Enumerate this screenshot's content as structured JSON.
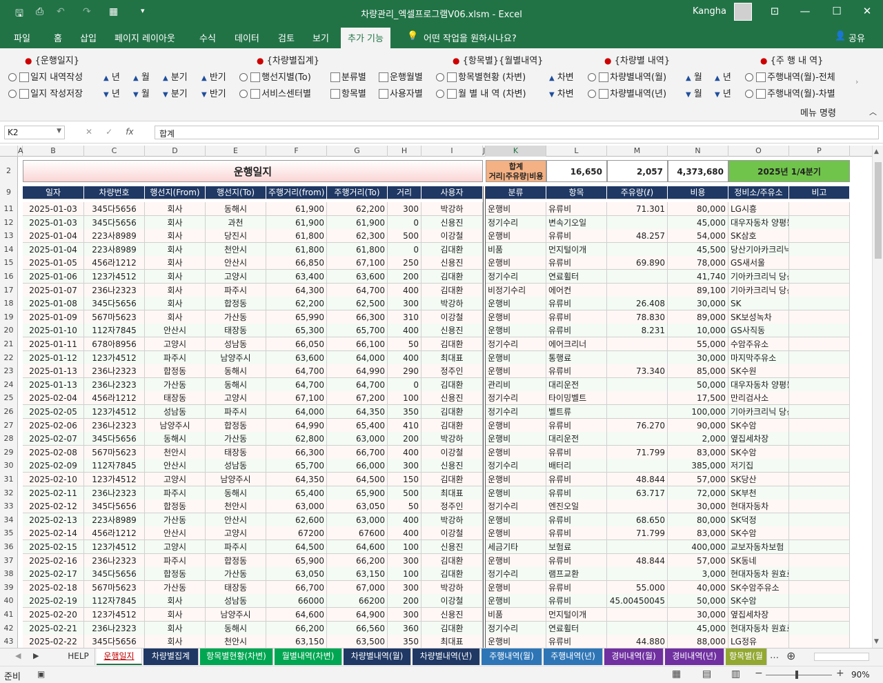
{
  "window": {
    "title": "차량관리_엑셀프로그램V06.xlsm  -  Excel",
    "user": "Kangha"
  },
  "tabs": [
    "파일",
    "홈",
    "삽입",
    "페이지 레이아웃",
    "수식",
    "데이터",
    "검토",
    "보기",
    "추가 기능",
    "어떤 작업을 원하시나요?",
    "공유"
  ],
  "ribbon": {
    "groups": [
      "{운행일지}",
      "{차량별집계}",
      "{항목별}{월별내역}",
      "{차량별 내역}",
      "{주 행 내 역}"
    ],
    "row1": [
      "일지 내역작성",
      "년",
      "월",
      "분기",
      "반기",
      "행선지별(To)",
      "분류별",
      "운행월별",
      "항목별현황 (차변)",
      "차변",
      "차량별내역(월)",
      "월",
      "년",
      "주행내역(월)-전체"
    ],
    "row2": [
      "일지 작성저장",
      "년",
      "월",
      "분기",
      "반기",
      "서비스센터별",
      "항목별",
      "사용자별",
      "월 별 내 역 (차변)",
      "차변",
      "차량별내역(년)",
      "월",
      "년",
      "주행내역(월)-차별"
    ],
    "footer": "메뉴 명령"
  },
  "formula": {
    "namebox": "K2",
    "value": "합계"
  },
  "columns": [
    "A",
    "B",
    "C",
    "D",
    "E",
    "F",
    "G",
    "H",
    "I",
    "J",
    "K",
    "L",
    "M",
    "N",
    "O",
    "P"
  ],
  "summary": {
    "title": "운행일지",
    "label1": "합계",
    "label2": "거리|주유량|비용",
    "distance": "16,650",
    "fuel": "2,057",
    "cost": "4,373,680",
    "period": "2025년 1/4분기"
  },
  "headers": [
    "일자",
    "차량번호",
    "행선지(From)",
    "행선지(To)",
    "주행거리(from)",
    "주행거리(To)",
    "거리",
    "사용자",
    "분류",
    "항목",
    "주유량(ℓ)",
    "비용",
    "정비소/주유소",
    "비고"
  ],
  "rows": [
    [
      "2025-01-03",
      "345다5656",
      "회사",
      "동해시",
      "61,900",
      "62,200",
      "300",
      "박강하",
      "운행비",
      "유류비",
      "71.301",
      "80,000",
      "LG시흥"
    ],
    [
      "2025-01-03",
      "345다5656",
      "회사",
      "과천",
      "61,900",
      "61,900",
      "0",
      "신용진",
      "정기수리",
      "변속기오일",
      "",
      "45,000",
      "대우자동차 양평동"
    ],
    [
      "2025-01-04",
      "223사8989",
      "회사",
      "당진시",
      "61,800",
      "62,300",
      "500",
      "이강철",
      "운행비",
      "유류비",
      "48.257",
      "54,000",
      "SK삼호"
    ],
    [
      "2025-01-04",
      "223사8989",
      "회사",
      "천안시",
      "61,800",
      "61,800",
      "0",
      "김대환",
      "비품",
      "먼지털이개",
      "",
      "45,500",
      "당산기아카크리닉"
    ],
    [
      "2025-01-05",
      "456라1212",
      "회사",
      "안산시",
      "66,850",
      "67,100",
      "250",
      "신용진",
      "운행비",
      "유류비",
      "69.890",
      "78,000",
      "GS새서울"
    ],
    [
      "2025-01-06",
      "123가4512",
      "회사",
      "고양시",
      "63,400",
      "63,600",
      "200",
      "김대환",
      "정기수리",
      "연료휠터",
      "",
      "41,740",
      "기아카크리닉 당산점"
    ],
    [
      "2025-01-07",
      "236나2323",
      "회사",
      "파주시",
      "64,300",
      "64,700",
      "400",
      "김대환",
      "비정기수리",
      "에어컨",
      "",
      "89,100",
      "기아카크리닉 당산점"
    ],
    [
      "2025-01-08",
      "345다5656",
      "회사",
      "합정동",
      "62,200",
      "62,500",
      "300",
      "박강하",
      "운행비",
      "유류비",
      "26.408",
      "30,000",
      "SK"
    ],
    [
      "2025-01-09",
      "567마5623",
      "회사",
      "가산동",
      "65,990",
      "66,300",
      "310",
      "이강철",
      "운행비",
      "유류비",
      "78.830",
      "89,000",
      "SK보성녹차"
    ],
    [
      "2025-01-10",
      "112자7845",
      "안산시",
      "태장동",
      "65,300",
      "65,700",
      "400",
      "신용진",
      "운행비",
      "유류비",
      "8.231",
      "10,000",
      "GS사직동"
    ],
    [
      "2025-01-11",
      "678아8956",
      "고양시",
      "성남동",
      "66,050",
      "66,100",
      "50",
      "김대환",
      "정기수리",
      "에어크리너",
      "",
      "55,000",
      "수암주유소"
    ],
    [
      "2025-01-12",
      "123가4512",
      "파주시",
      "남양주시",
      "63,600",
      "64,000",
      "400",
      "최대표",
      "운행비",
      "통행료",
      "",
      "30,000",
      "마지막주유소"
    ],
    [
      "2025-01-13",
      "236나2323",
      "합정동",
      "동해시",
      "64,700",
      "64,990",
      "290",
      "정주인",
      "운행비",
      "유류비",
      "73.340",
      "85,000",
      "SK수원"
    ],
    [
      "2025-01-13",
      "236나2323",
      "가산동",
      "동해시",
      "64,700",
      "64,700",
      "0",
      "김대환",
      "관리비",
      "대리운전",
      "",
      "50,000",
      "대우자동차 양평동"
    ],
    [
      "2025-02-04",
      "456라1212",
      "태장동",
      "고양시",
      "67,100",
      "67,200",
      "100",
      "신용진",
      "정기수리",
      "타이밍벨트",
      "",
      "17,500",
      "만리검사소"
    ],
    [
      "2025-02-05",
      "123가4512",
      "성남동",
      "파주시",
      "64,000",
      "64,350",
      "350",
      "김대환",
      "정기수리",
      "벨트류",
      "",
      "100,000",
      "기아카크리닉 당산점"
    ],
    [
      "2025-02-06",
      "236나2323",
      "남양주시",
      "합정동",
      "64,990",
      "65,400",
      "410",
      "김대환",
      "운행비",
      "유류비",
      "76.270",
      "90,000",
      "SK수암"
    ],
    [
      "2025-02-07",
      "345다5656",
      "동해시",
      "가산동",
      "62,800",
      "63,000",
      "200",
      "박강하",
      "운행비",
      "대리운전",
      "",
      "2,000",
      "옆집세차장"
    ],
    [
      "2025-02-08",
      "567마5623",
      "천안시",
      "태장동",
      "66,300",
      "66,700",
      "400",
      "이강철",
      "운행비",
      "유류비",
      "71.799",
      "83,000",
      "SK수암"
    ],
    [
      "2025-02-09",
      "112자7845",
      "안산시",
      "성남동",
      "65,700",
      "66,000",
      "300",
      "신용진",
      "정기수리",
      "배터리",
      "",
      "385,000",
      "저기집"
    ],
    [
      "2025-02-10",
      "123가4512",
      "고양시",
      "남양주시",
      "64,350",
      "64,500",
      "150",
      "김대환",
      "운행비",
      "유류비",
      "48.844",
      "57,000",
      "SK당산"
    ],
    [
      "2025-02-11",
      "236나2323",
      "파주시",
      "동해시",
      "65,400",
      "65,900",
      "500",
      "최대표",
      "운행비",
      "유류비",
      "63.717",
      "72,000",
      "SK부천"
    ],
    [
      "2025-02-12",
      "345다5656",
      "합정동",
      "천안시",
      "63,000",
      "63,050",
      "50",
      "정주인",
      "정기수리",
      "엔진오일",
      "",
      "30,000",
      "현대자동차"
    ],
    [
      "2025-02-13",
      "223사8989",
      "가산동",
      "안산시",
      "62,600",
      "63,000",
      "400",
      "박강하",
      "운행비",
      "유류비",
      "68.650",
      "80,000",
      "SK덕정"
    ],
    [
      "2025-02-14",
      "456라1212",
      "안산시",
      "고양시",
      "67200",
      "67600",
      "400",
      "이강철",
      "운행비",
      "유류비",
      "71.799",
      "83,000",
      "SK수암"
    ],
    [
      "2025-02-15",
      "123가4512",
      "고양시",
      "파주시",
      "64,500",
      "64,600",
      "100",
      "신용진",
      "세금기타",
      "보험료",
      "",
      "400,000",
      "교보자동차보험"
    ],
    [
      "2025-02-16",
      "236나2323",
      "파주시",
      "합정동",
      "65,900",
      "66,200",
      "300",
      "김대환",
      "운행비",
      "유류비",
      "48.844",
      "57,000",
      "SK동네"
    ],
    [
      "2025-02-17",
      "345다5656",
      "합정동",
      "가산동",
      "63,050",
      "63,150",
      "100",
      "김대환",
      "정기수리",
      "램프교환",
      "",
      "3,000",
      "현대자동차 원효로"
    ],
    [
      "2025-02-18",
      "567마5623",
      "가산동",
      "태장동",
      "66,700",
      "67,000",
      "300",
      "박강하",
      "운행비",
      "유류비",
      "55.000",
      "40,000",
      "SK수암주유소"
    ],
    [
      "2025-02-19",
      "112자7845",
      "회사",
      "성남동",
      "66000",
      "66200",
      "200",
      "이강철",
      "운행비",
      "유류비",
      "45.00450045",
      "50,000",
      "SK수암"
    ],
    [
      "2025-02-20",
      "123가4512",
      "회사",
      "남양주시",
      "64,600",
      "64,900",
      "300",
      "신용진",
      "비품",
      "먼지털이개",
      "",
      "30,000",
      "옆집세차장"
    ],
    [
      "2025-02-21",
      "236나2323",
      "회사",
      "동해시",
      "66,200",
      "66,560",
      "360",
      "김대환",
      "정기수리",
      "연료휠터",
      "",
      "45,000",
      "현대자동차 원효로"
    ],
    [
      "2025-02-22",
      "345다5656",
      "회사",
      "천안시",
      "63,150",
      "63,500",
      "350",
      "최대표",
      "운행비",
      "유류비",
      "44.880",
      "88,000",
      "LG정유"
    ]
  ],
  "rownums": [
    "11",
    "12",
    "13",
    "14",
    "15",
    "16",
    "17",
    "18",
    "19",
    "20",
    "21",
    "22",
    "23",
    "24",
    "25",
    "26",
    "27",
    "28",
    "29",
    "30",
    "31",
    "32",
    "33",
    "34",
    "35",
    "36",
    "37",
    "38",
    "39",
    "40",
    "41",
    "42",
    "43"
  ],
  "sheets": [
    {
      "label": "HELP",
      "bg": "#f3f3f3",
      "fg": "#333"
    },
    {
      "label": "운행일지",
      "bg": "#ffffff",
      "fg": "#c00000"
    },
    {
      "label": "차량별집계",
      "bg": "#1f3864",
      "fg": "#ffffff"
    },
    {
      "label": "항목별현황(차변)",
      "bg": "#00a651",
      "fg": "#ffffff"
    },
    {
      "label": "월별내역(차변)",
      "bg": "#00a651",
      "fg": "#ffffff"
    },
    {
      "label": "차량별내역(월)",
      "bg": "#1f3864",
      "fg": "#ffffff"
    },
    {
      "label": "차량별내역(년)",
      "bg": "#1f3864",
      "fg": "#ffffff"
    },
    {
      "label": "주행내역(월)",
      "bg": "#2e75b6",
      "fg": "#ffffff"
    },
    {
      "label": "주행내역(년)",
      "bg": "#2e75b6",
      "fg": "#ffffff"
    },
    {
      "label": "경비내역(월)",
      "bg": "#7030a0",
      "fg": "#ffffff"
    },
    {
      "label": "경비내역(년)",
      "bg": "#7030a0",
      "fg": "#ffffff"
    },
    {
      "label": "항목별(월",
      "bg": "#92a832",
      "fg": "#ffffff"
    }
  ],
  "status": {
    "mode": "준비",
    "zoom": "90%"
  },
  "colors": {
    "excel_green": "#217346",
    "header_navy": "#1f3864",
    "period_green": "#70c34b",
    "title_pink": "#fde3e3"
  }
}
